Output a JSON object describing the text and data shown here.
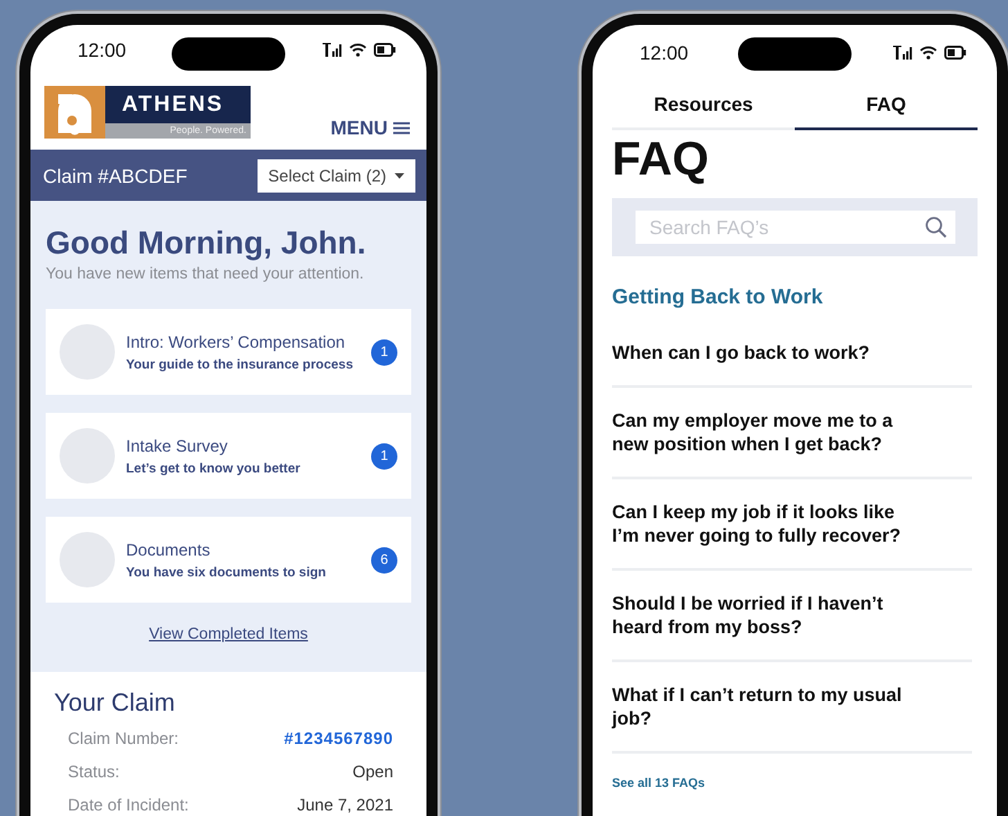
{
  "dashboard": {
    "status_bar": {
      "time": "12:00"
    },
    "logo": {
      "name": "ATHENS",
      "tagline": "People. Powered."
    },
    "menu": {
      "label": "MENU"
    },
    "claim_bar": {
      "title": "Claim #ABCDEF",
      "select": "Select Claim (2)"
    },
    "greeting": "Good Morning, John.",
    "subtitle": "You have new items that need your attention.",
    "tasks": [
      {
        "title": "Intro: Workers’ Compensation",
        "subtitle": "Your guide to the insurance process",
        "count": "1"
      },
      {
        "title": "Intake Survey",
        "subtitle": "Let’s get to know you better",
        "count": "1"
      },
      {
        "title": "Documents",
        "subtitle": "You have six documents to sign",
        "count": "6"
      }
    ],
    "completed_link": "View Completed Items",
    "claim": {
      "title": "Your Claim",
      "rows": [
        {
          "label": "Claim Number:",
          "value": "#1234567890",
          "kind": "link"
        },
        {
          "label": "Status:",
          "value": "Open",
          "kind": "plain"
        },
        {
          "label": "Date of Incident:",
          "value": "June 7, 2021",
          "kind": "plain"
        }
      ]
    }
  },
  "faq": {
    "status_bar": {
      "time": "12:00"
    },
    "tabs": [
      {
        "label": "Resources",
        "selected": false
      },
      {
        "label": "FAQ",
        "selected": true
      }
    ],
    "heading": "FAQ",
    "search": {
      "placeholder": "Search FAQ’s"
    },
    "section": "Getting Back to Work",
    "questions": [
      "When can I go back to work?",
      "Can my employer move me to a new position when I get back?",
      "Can I keep my job if it looks like I’m never going to fully recover?",
      "Should I be worried if I haven’t heard from my boss?",
      "What if I can’t return to my usual job?"
    ],
    "see_all": "See all 13 FAQs"
  }
}
